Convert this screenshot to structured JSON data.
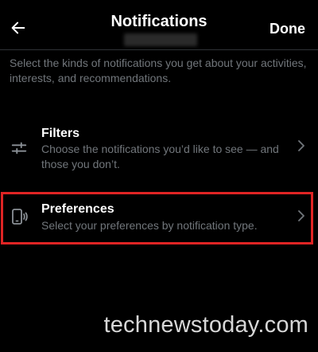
{
  "header": {
    "title": "Notifications",
    "done_label": "Done",
    "back_icon": "arrow-left-icon"
  },
  "intro": "Select the kinds of notifications you get about your activities, interests, and recommendations.",
  "rows": [
    {
      "label": "Filters",
      "description": "Choose the notifications you’d like to see — and those you don’t.",
      "icon": "sliders-icon"
    },
    {
      "label": "Preferences",
      "description": "Select your preferences by notification type.",
      "icon": "phone-vibrate-icon"
    }
  ],
  "watermark": "technewstoday.com",
  "colors": {
    "background": "#000000",
    "text_primary": "#ffffff",
    "text_secondary": "#71767b",
    "highlight": "#e02424"
  }
}
